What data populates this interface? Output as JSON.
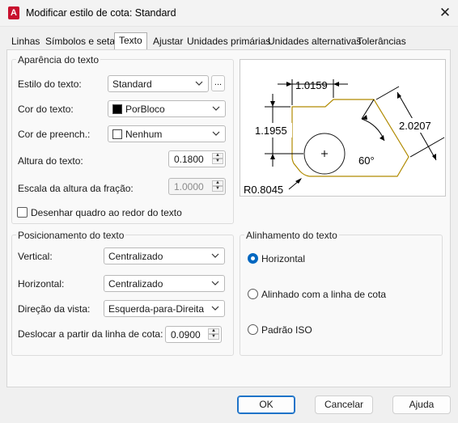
{
  "window": {
    "title": "Modificar estilo de cota: Standard",
    "app_icon_letter": "A"
  },
  "tabs": [
    "Linhas",
    "Símbolos e setas",
    "Texto",
    "Ajustar",
    "Unidades primárias",
    "Unidades alternativas",
    "Tolerâncias"
  ],
  "active_tab": "Texto",
  "appearance": {
    "legend": "Aparência do texto",
    "style_label": "Estilo do texto:",
    "style_value": "Standard",
    "style_button": "...",
    "color_label": "Cor do texto:",
    "color_value": "PorBloco",
    "fill_label": "Cor de preench.:",
    "fill_value": "Nenhum",
    "height_label": "Altura do texto:",
    "height_value": "0.1800",
    "fraction_label": "Escala da altura da fração:",
    "fraction_value": "1.0000",
    "frame_label": "Desenhar quadro ao redor do texto"
  },
  "placement": {
    "legend": "Posicionamento do texto",
    "vertical_label": "Vertical:",
    "vertical_value": "Centralizado",
    "horizontal_label": "Horizontal:",
    "horizontal_value": "Centralizado",
    "view_label": "Direção da vista:",
    "view_value": "Esquerda-para-Direita",
    "offset_label": "Deslocar a partir da linha de cota:",
    "offset_value": "0.0900"
  },
  "alignment": {
    "legend": "Alinhamento do texto",
    "options": [
      "Horizontal",
      "Alinhado com a linha de cota",
      "Padrão ISO"
    ],
    "selected": "Horizontal"
  },
  "preview": {
    "dim_top": "1.0159",
    "dim_left": "1.1955",
    "dim_right": "2.0207",
    "dim_angle": "60°",
    "dim_radius": "R0.8045"
  },
  "buttons": {
    "ok": "OK",
    "cancel": "Cancelar",
    "help": "Ajuda"
  },
  "colors": {
    "accent": "#0067c0",
    "part_outline": "#b08a00",
    "close_icon": "#222222"
  }
}
